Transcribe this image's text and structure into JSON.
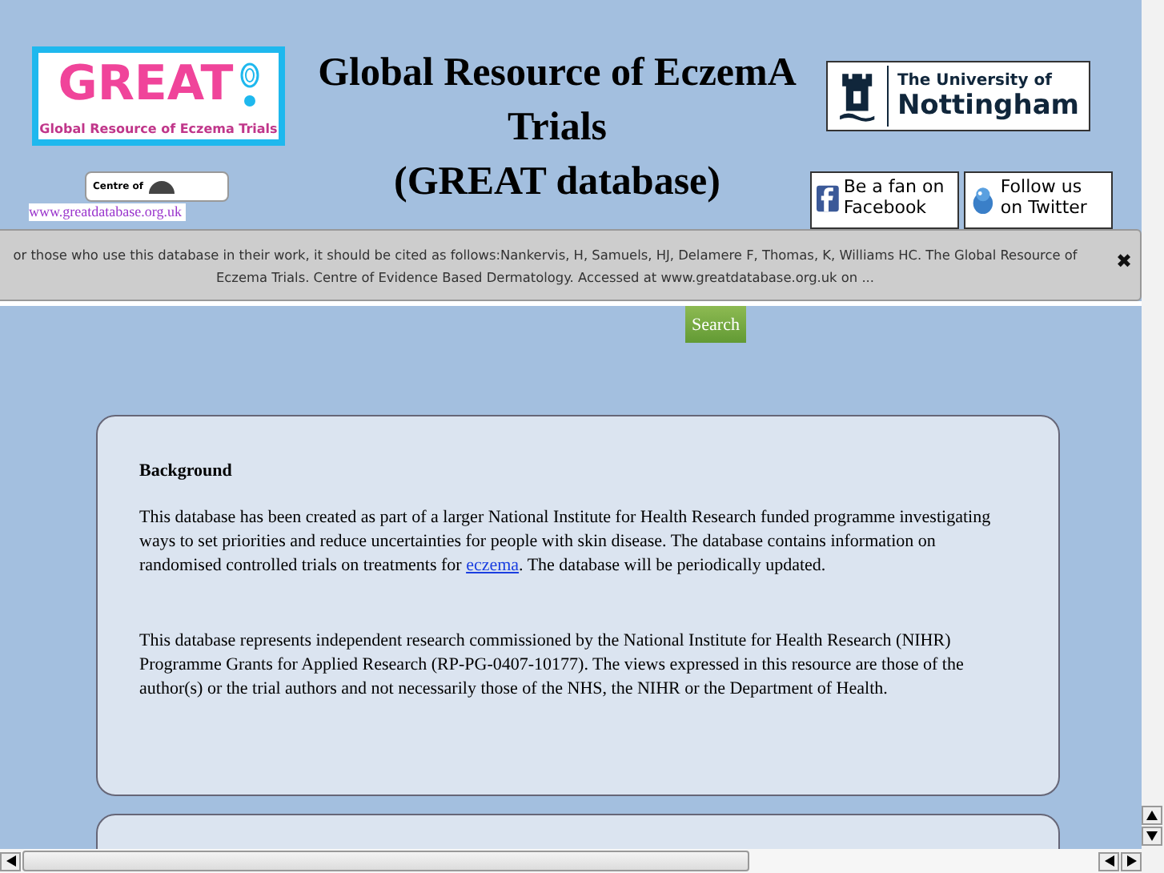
{
  "header": {
    "logo": {
      "title": "GREAT",
      "subtitle": "Global Resource of Eczema Trials"
    },
    "title_lines": [
      "Global Resource of EczemA",
      "Trials",
      "(GREAT database)"
    ],
    "partner_logo": {
      "text": "Centre of"
    },
    "site_url": "www.greatdatabase.org.uk",
    "university_logo": {
      "line_1": "The University of",
      "line_2": "Nottingham"
    },
    "social": [
      {
        "kind": "facebook",
        "label": "Be a fan on Facebook"
      },
      {
        "kind": "twitter",
        "label": "Follow us on Twitter"
      }
    ]
  },
  "notice": {
    "text": "or those who use this database in their work, it should be cited as follows:Nankervis, H, Samuels, HJ, Delamere F, Thomas, K, Williams HC. The Global Resource of Eczema Trials. Centre of Evidence Based Dermatology. Accessed at www.greatdatabase.org.uk on ...",
    "close": "✖"
  },
  "search": {
    "button": "Search"
  },
  "background_card": {
    "heading": "Background",
    "paragraphs": [
      {
        "before": "This database has been created as part of a larger National Institute for Health Research funded programme investigating ways to set priorities and reduce uncertainties for people with skin disease. The database contains information on randomised controlled trials on treatments for ",
        "link": "eczema",
        "after": ". The database will be periodically updated."
      },
      {
        "before": "This database represents independent research commissioned by the National Institute for Health Research (NIHR) Programme Grants for Applied Research (RP-PG-0407-10177). The views expressed in this resource are those of the author(s) or the trial authors and not necessarily those of the NHS, the NIHR or the Department of Health."
      }
    ]
  }
}
